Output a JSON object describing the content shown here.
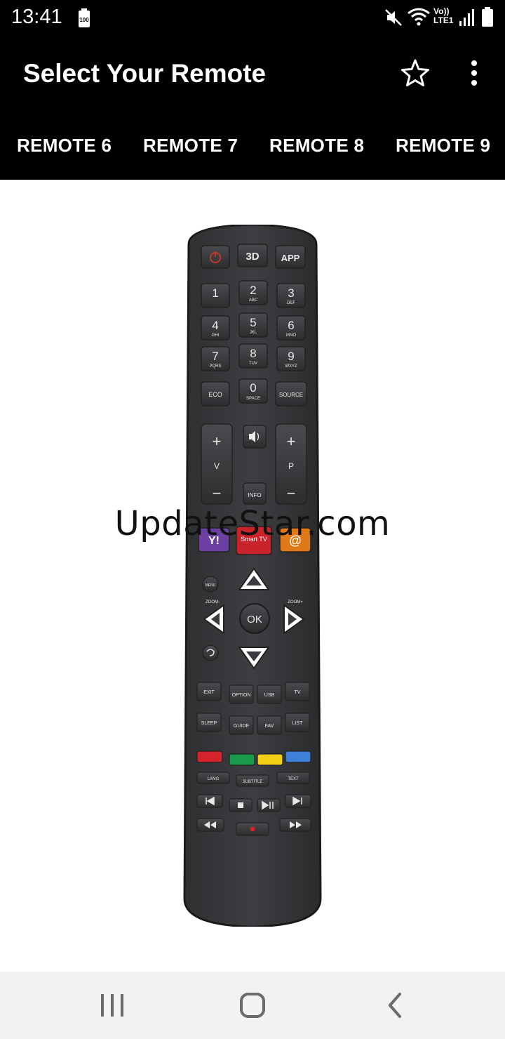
{
  "status_bar": {
    "time": "13:41",
    "battery_level_text": "100",
    "network_label": "Vo)) LTE1",
    "icons": [
      "battery-saver-icon",
      "mute-icon",
      "wifi-icon",
      "lte-icon",
      "signal-icon",
      "battery-icon"
    ]
  },
  "app_bar": {
    "title": "Select Your Remote",
    "actions": [
      "star-icon",
      "more-vert-icon"
    ]
  },
  "tabs": [
    {
      "label": "REMOTE 6"
    },
    {
      "label": "REMOTE 7"
    },
    {
      "label": "REMOTE 8"
    },
    {
      "label": "REMOTE 9"
    }
  ],
  "watermark": "UpdateStar.com",
  "remote": {
    "top_row": [
      "3D",
      "APP"
    ],
    "digits": [
      {
        "num": "1",
        "sub": ""
      },
      {
        "num": "2",
        "sub": "ABC"
      },
      {
        "num": "3",
        "sub": "DEF"
      },
      {
        "num": "4",
        "sub": "GHI"
      },
      {
        "num": "5",
        "sub": "JKL"
      },
      {
        "num": "6",
        "sub": "MNO"
      },
      {
        "num": "7",
        "sub": "PQRS"
      },
      {
        "num": "8",
        "sub": "TUV"
      },
      {
        "num": "9",
        "sub": "WXYZ"
      }
    ],
    "row_zero": {
      "left": "ECO",
      "num": "0",
      "sub": "SPACE",
      "right": "SOURCE"
    },
    "volume": {
      "plus": "+",
      "label": "V",
      "minus": "−"
    },
    "program": {
      "plus": "+",
      "label": "P",
      "minus": "−"
    },
    "info": "INFO",
    "smart_row": {
      "left": "Y!",
      "center": "Smart TV",
      "right": "@"
    },
    "menu": "MENU",
    "zoom_minus": "ZOOM-",
    "zoom_plus": "ZOOM+",
    "ok": "OK",
    "func_row1": [
      "EXIT",
      "OPTION",
      "USB",
      "TV"
    ],
    "func_row2": [
      "SLEEP",
      "GUIDE",
      "FAV",
      "LIST"
    ],
    "color_keys": [
      "#d4232a",
      "#1a9a4b",
      "#f0cf15",
      "#3f7fd6"
    ],
    "lang_row": [
      "LANG",
      "SUBTITLE",
      "TEXT"
    ],
    "media_row1": [
      "prev-icon",
      "stop-icon",
      "play-pause-icon",
      "next-icon"
    ],
    "media_row2": [
      "rewind-icon",
      "record-icon",
      "fast-forward-icon"
    ]
  },
  "nav_bar": [
    "recents-icon",
    "home-icon",
    "back-icon"
  ]
}
